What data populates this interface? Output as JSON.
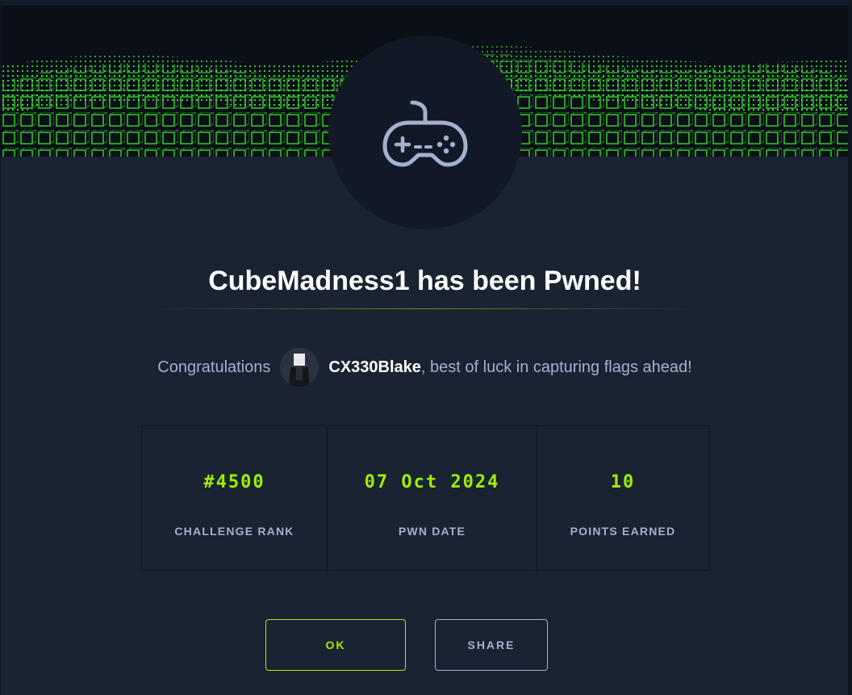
{
  "modal": {
    "title": "CubeMadness1 has been Pwned!",
    "banner_icon": "gamepad-icon"
  },
  "congrats": {
    "prefix": "Congratulations",
    "username": "CX330Blake",
    "suffix": ", best of luck in capturing flags ahead!"
  },
  "stats": [
    {
      "value": "#4500",
      "label": "CHALLENGE RANK"
    },
    {
      "value": "07 Oct 2024",
      "label": "PWN DATE"
    },
    {
      "value": "10",
      "label": "POINTS EARNED"
    }
  ],
  "actions": {
    "ok_label": "OK",
    "share_label": "SHARE"
  },
  "colors": {
    "accent": "#9fef00",
    "background": "#1a2332",
    "muted_text": "#a4b1cd"
  }
}
